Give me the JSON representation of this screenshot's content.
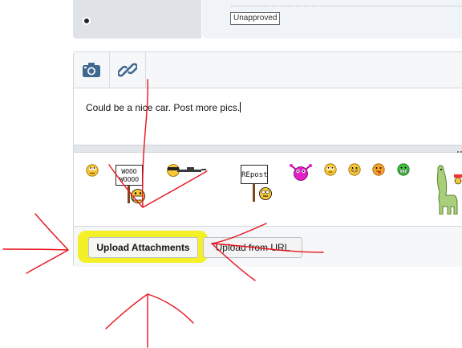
{
  "post": {
    "status_badge": "Unapproved"
  },
  "toolbar": {
    "image_icon": "camera-icon",
    "link_icon": "link-icon"
  },
  "editor": {
    "content": "Could be a nice car. Post more pics."
  },
  "smilies": {
    "sign_text_1": "WOOO\nWOOOO",
    "sign_text_2": "REpost"
  },
  "actions": {
    "upload_attachments_label": "Upload Attachments",
    "upload_url_label": "Upload from URL"
  },
  "colors": {
    "highlight": "#f3ef1b",
    "annotation": "#e8141c",
    "icon": "#3f6890"
  }
}
